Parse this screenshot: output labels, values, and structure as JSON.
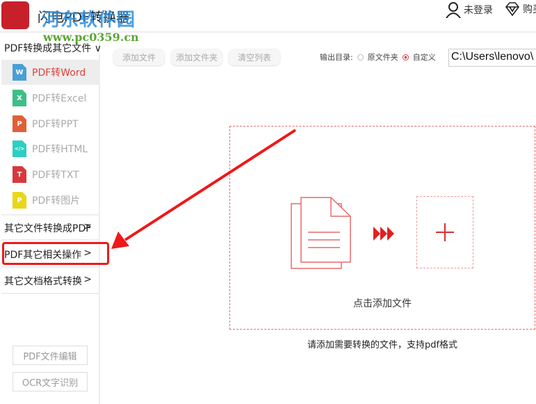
{
  "app": {
    "title": "闪电PDF转换器",
    "user_label": "未登录",
    "buy_label": "购买"
  },
  "watermark": {
    "name": "河东软件园",
    "url": "www.pc0359.cn"
  },
  "sidebar": {
    "section_title": "PDF转换成其它文件",
    "items": [
      {
        "label": "PDF转Word",
        "icon": "W",
        "color": "#4a9fd8"
      },
      {
        "label": "PDF转Excel",
        "icon": "X",
        "color": "#3cbf88"
      },
      {
        "label": "PDF转PPT",
        "icon": "P",
        "color": "#e0603a"
      },
      {
        "label": "PDF转HTML",
        "icon": "</>",
        "color": "#2ecfc0"
      },
      {
        "label": "PDF转TXT",
        "icon": "T",
        "color": "#d8383c"
      },
      {
        "label": "PDF转图片",
        "icon": "P",
        "color": "#e8d818"
      }
    ],
    "groups": [
      "其它文件转换成PDF",
      "PDF其它相关操作",
      "其它文档格式转换"
    ],
    "bottom_buttons": [
      "PDF文件编辑",
      "OCR文字识别"
    ]
  },
  "toolbar": {
    "add_file": "添加文件",
    "add_folder": "添加文件夹",
    "clear_list": "清空列表"
  },
  "output": {
    "label": "输出目录:",
    "option_original": "原文件夹",
    "option_custom": "自定义",
    "selected": "custom",
    "path": "C:\\Users\\lenovo\\"
  },
  "dropzone": {
    "action": "点击添加文件",
    "hint": "请添加需要转换的文件，支持pdf格式"
  },
  "colors": {
    "accent": "#e0403a",
    "annotation": "#f01818"
  }
}
